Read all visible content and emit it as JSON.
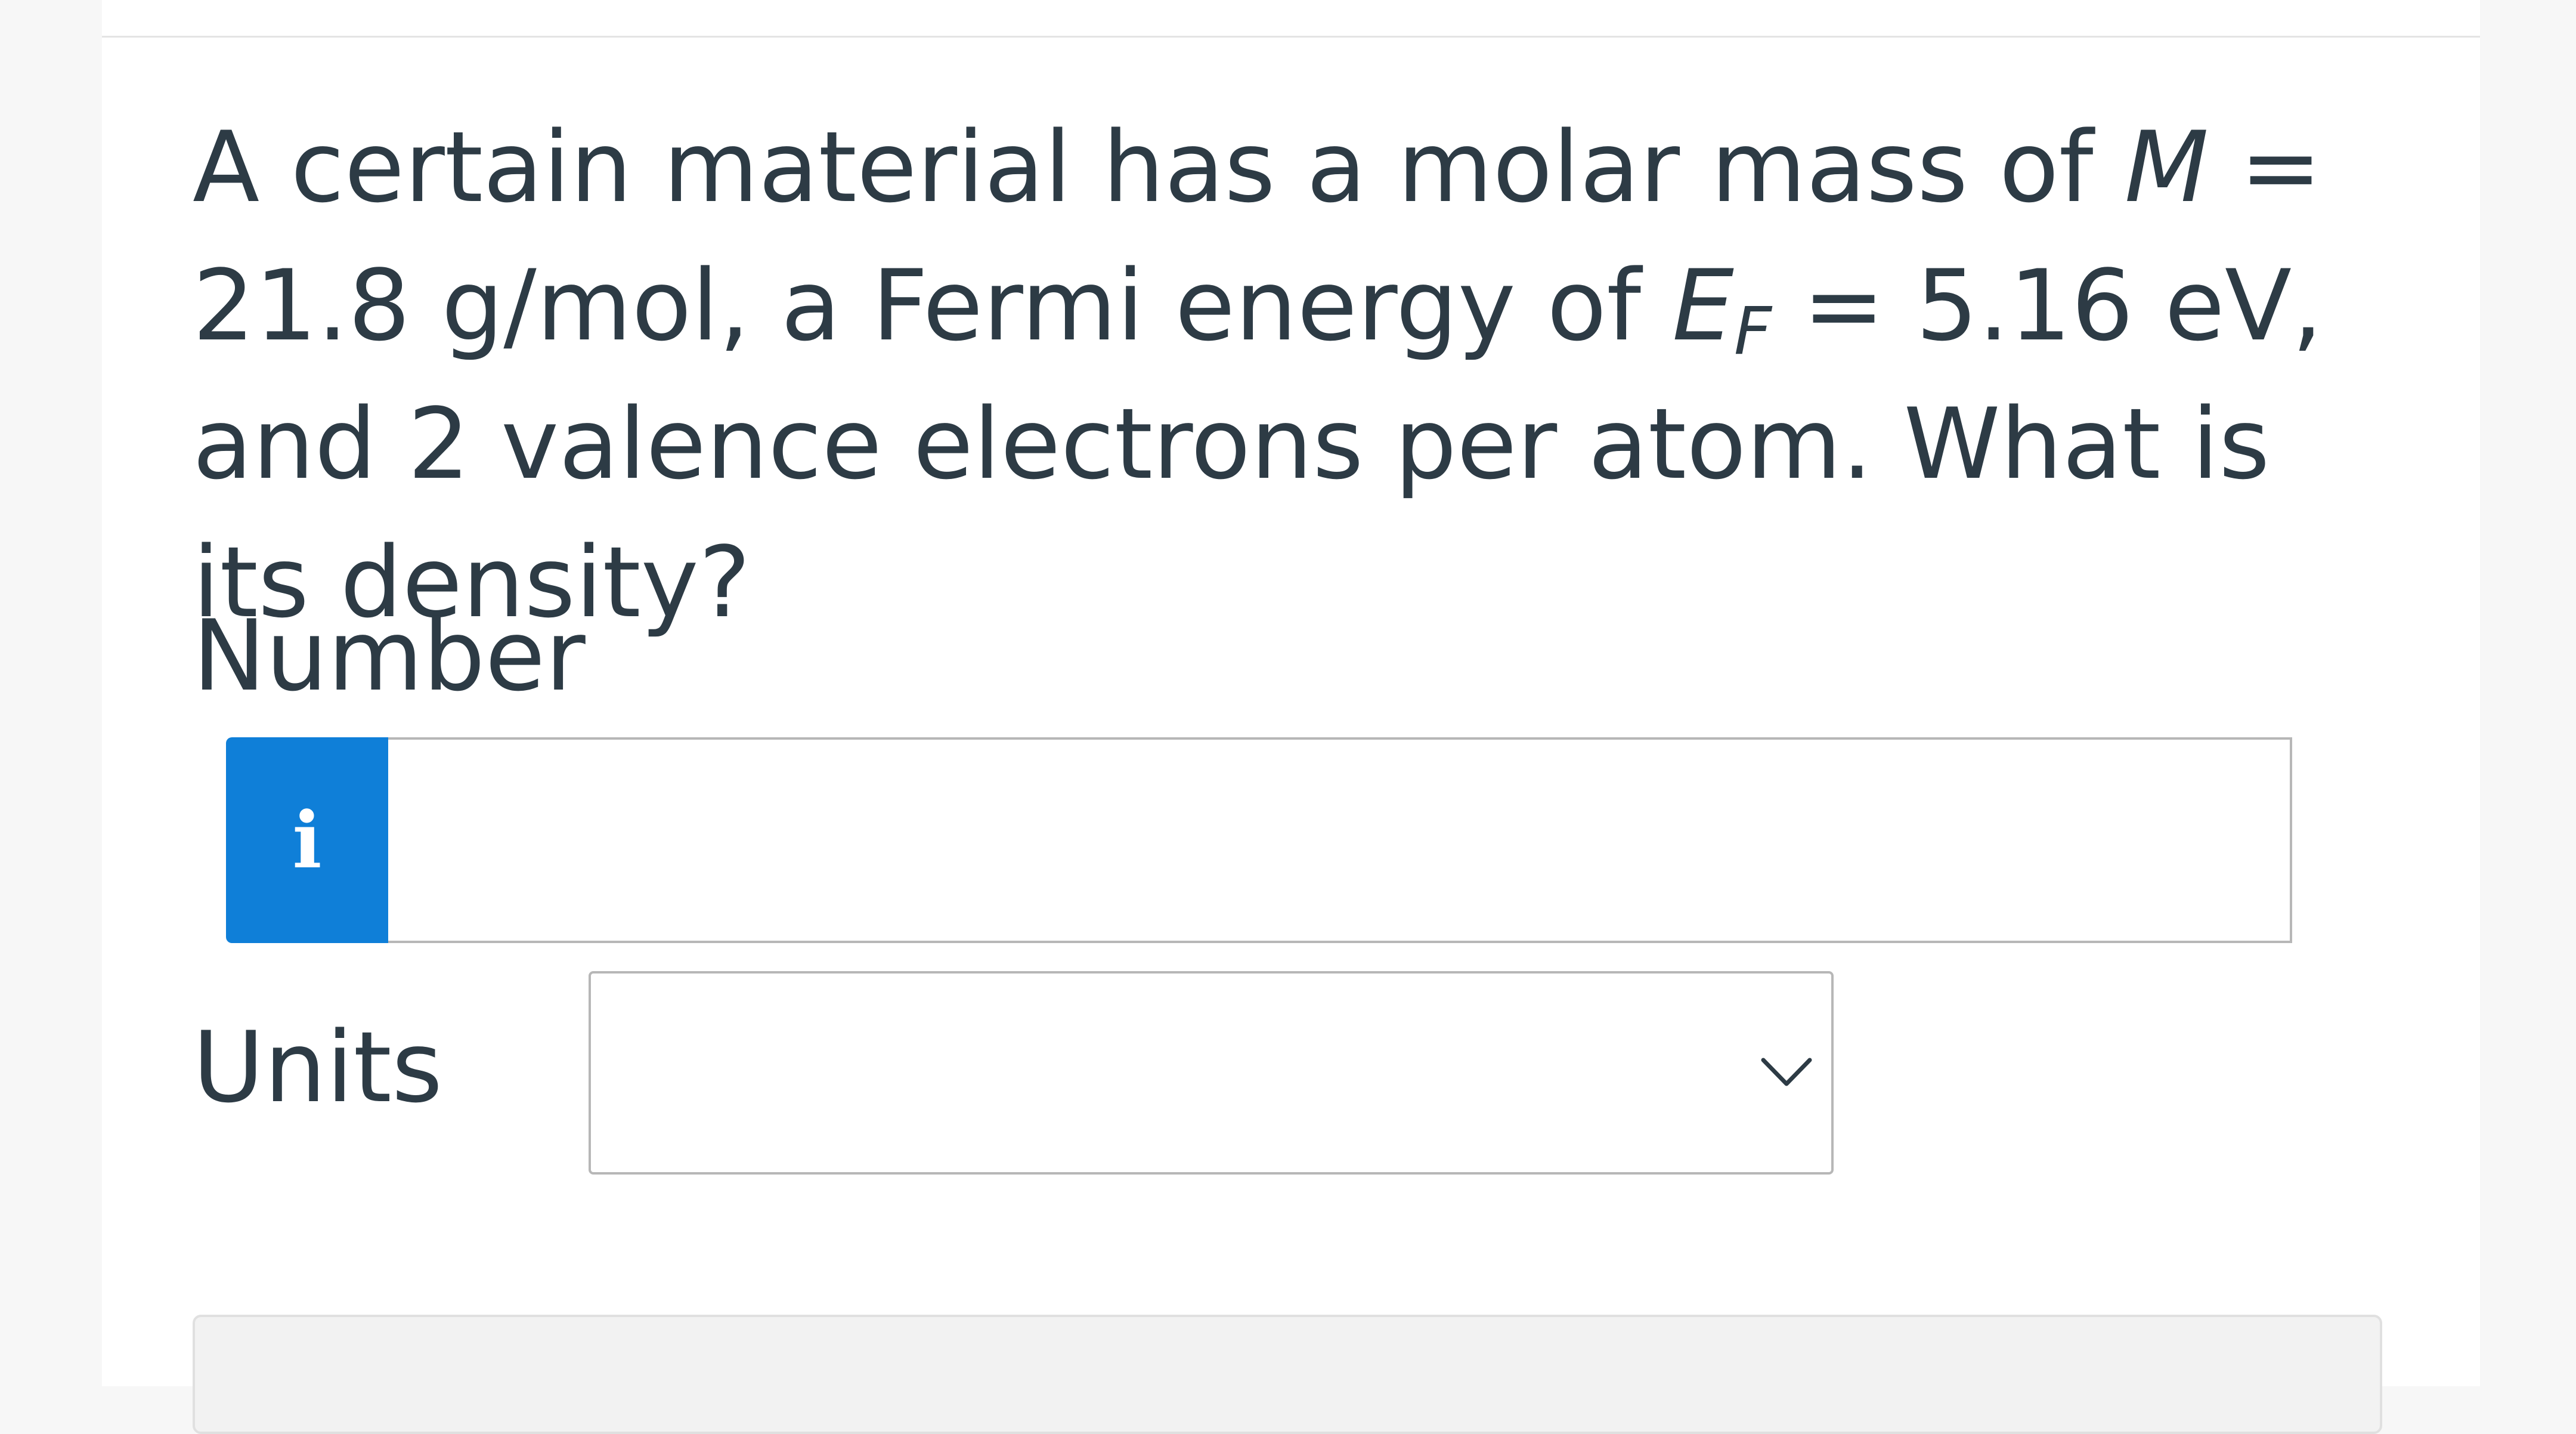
{
  "question": {
    "text_1": "A certain material has a molar mass of ",
    "symbol_m": "M",
    "text_2": " = 21.8 g/mol, a Fermi energy of ",
    "symbol_e": "E",
    "subscript_f": "F",
    "text_3": " = 5.16 eV, and 2 valence electrons per atom. What is its density?"
  },
  "number_field": {
    "label": "Number",
    "info_glyph": "i",
    "value": "",
    "info_color": "#0f7fd8"
  },
  "units_field": {
    "label": "Units",
    "selected_value": ""
  },
  "icons": {
    "info": "info-icon",
    "dropdown": "chevron-down-icon"
  }
}
